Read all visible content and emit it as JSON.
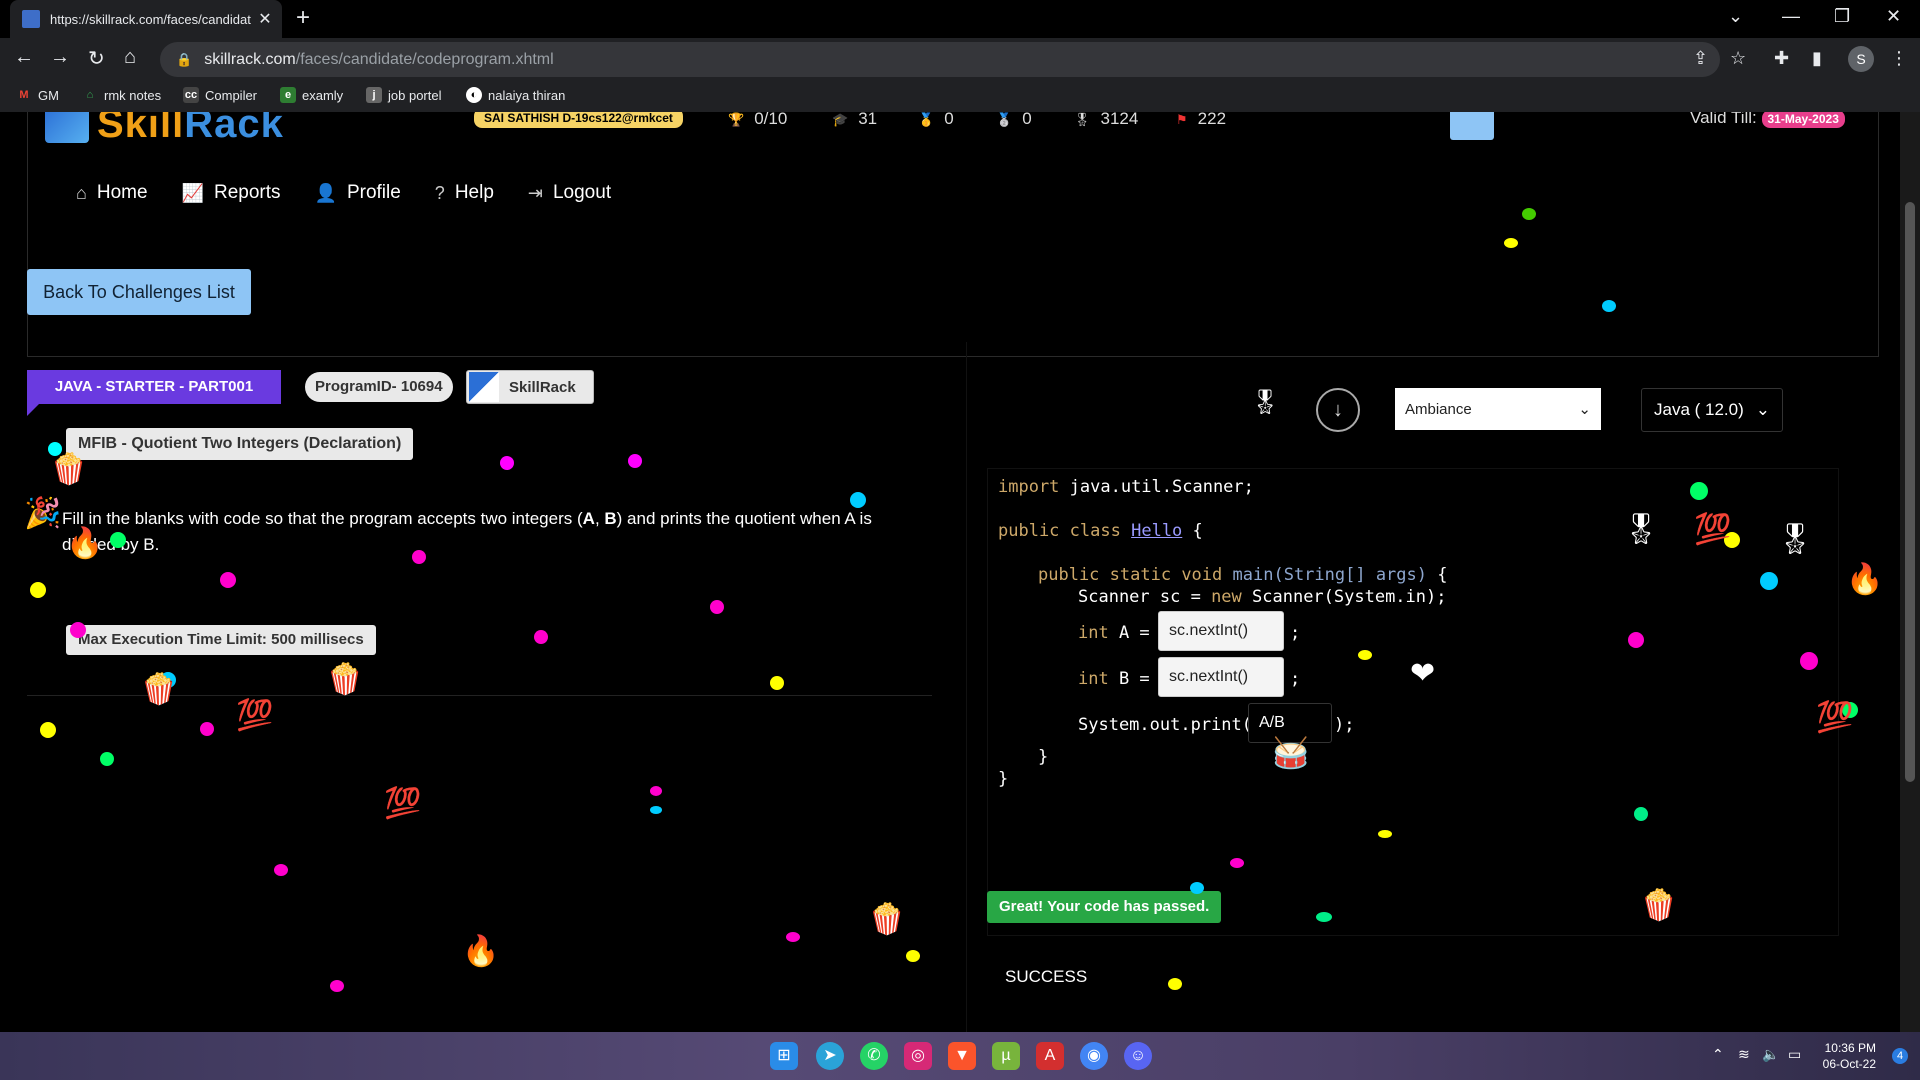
{
  "browser": {
    "tab_title": "https://skillrack.com/faces/candidat",
    "url_host": "skillrack.com",
    "url_path": "/faces/candidate/codeprogram.xhtml",
    "profile_initial": "S",
    "bookmarks": [
      {
        "label": "GM",
        "icon": "gmail-icon",
        "color": "#ea4335"
      },
      {
        "label": "rmk notes",
        "icon": "home-icon",
        "color": "#34a853"
      },
      {
        "label": "Compiler",
        "icon": "cc-icon",
        "color": "#444444"
      },
      {
        "label": "examly",
        "icon": "examly-icon",
        "color": "#2e7d32"
      },
      {
        "label": "job portel",
        "icon": "job-icon",
        "color": "#666666"
      },
      {
        "label": "nalaiya thiran",
        "icon": "nalaiya-icon",
        "color": "#ffffff"
      }
    ]
  },
  "header": {
    "logo_text_a": "Skill",
    "logo_text_b": "Rack",
    "user_badge": "SAI SATHISH D-19cs122@rmkcet",
    "stats": [
      "0/10",
      "31",
      "0",
      "0",
      "3124",
      "222"
    ],
    "valid_label": "Valid Till:",
    "valid_date": "31-May-2023"
  },
  "nav": {
    "home": "Home",
    "reports": "Reports",
    "profile": "Profile",
    "help": "Help",
    "logout": "Logout"
  },
  "back_button": "Back To Challenges List",
  "problem": {
    "track": "JAVA - STARTER - PART001",
    "program_id": "ProgramID- 10694",
    "source": "SkillRack",
    "title": "MFIB - Quotient Two Integers (Declaration)",
    "description_part1": "Fill in the blanks with code so that the program accepts two integers (",
    "var_a": "A",
    "sep": ", ",
    "var_b": "B",
    "description_part2": ") and prints the quotient when A is divided by B.",
    "time_limit": "Max Execution Time Limit: 500 millisecs"
  },
  "editor": {
    "theme": "Ambiance",
    "language": "Java ( 12.0)",
    "line_import": "import java.util.Scanner;",
    "kw_public": "public",
    "kw_class": "class",
    "class_name": "Hello",
    "brace_open": "{",
    "main_sig_static": "static void",
    "main_name": "main",
    "main_args": "(String[] args)",
    "scanner_line": "Scanner sc = ",
    "kw_new": "new",
    "scanner_ctor": " Scanner(System.in);",
    "int_a": "int A =",
    "int_b": "int B =",
    "semicolon": ";",
    "print_open": "System.out.print(",
    "print_close": ");",
    "brace_close": "}",
    "blank_1": "sc.nextInt()",
    "blank_2": "sc.nextInt()",
    "blank_3": "A/B"
  },
  "result": {
    "badge": "Great! Your code has passed.",
    "output": "SUCCESS"
  },
  "taskbar": {
    "time": "10:36 PM",
    "date": "06-Oct-22",
    "notifications": "4"
  },
  "colors": {
    "accent_blue": "#8ec5f5",
    "track_purple": "#6a3ae0",
    "success_green": "#28a745",
    "logo_orange": "#f0a017"
  }
}
